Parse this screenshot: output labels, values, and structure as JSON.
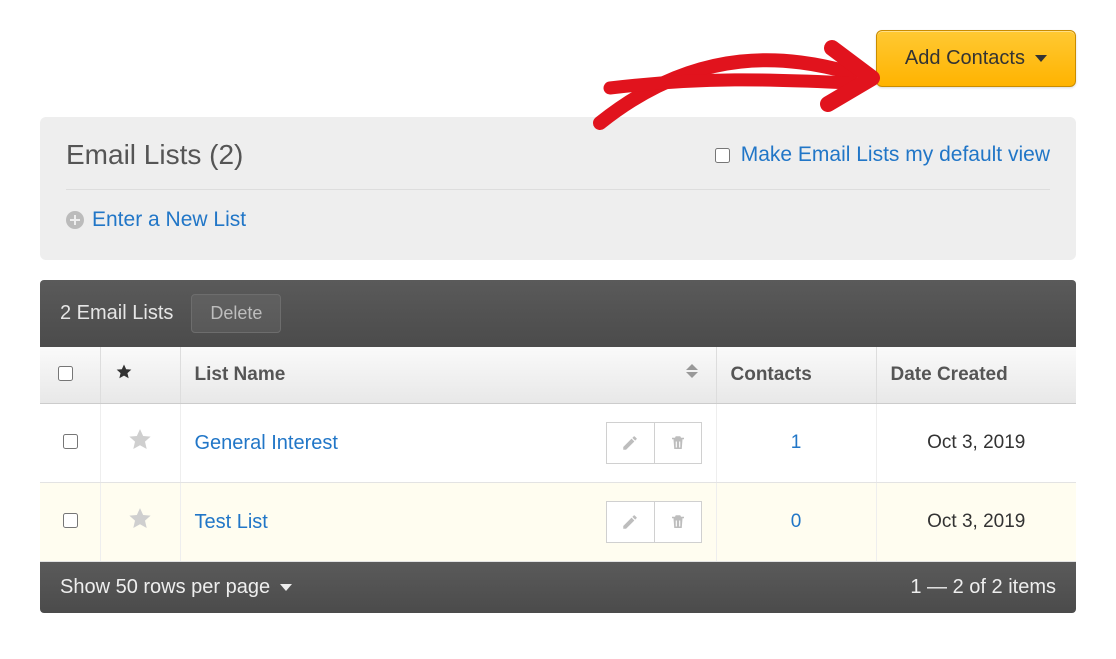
{
  "top": {
    "add_contacts_label": "Add Contacts"
  },
  "panel": {
    "title": "Email Lists (2)",
    "default_view_label": "Make Email Lists my default view",
    "new_list_label": "Enter a New List"
  },
  "toolbar": {
    "count_label": "2 Email Lists",
    "delete_label": "Delete"
  },
  "columns": {
    "name": "List Name",
    "contacts": "Contacts",
    "date": "Date Created"
  },
  "rows": [
    {
      "name": "General Interest",
      "contacts": "1",
      "date": "Oct 3, 2019"
    },
    {
      "name": "Test List",
      "contacts": "0",
      "date": "Oct 3, 2019"
    }
  ],
  "footer": {
    "rows_per_page": "Show 50 rows per page",
    "range": "1 — 2 of 2 items"
  }
}
